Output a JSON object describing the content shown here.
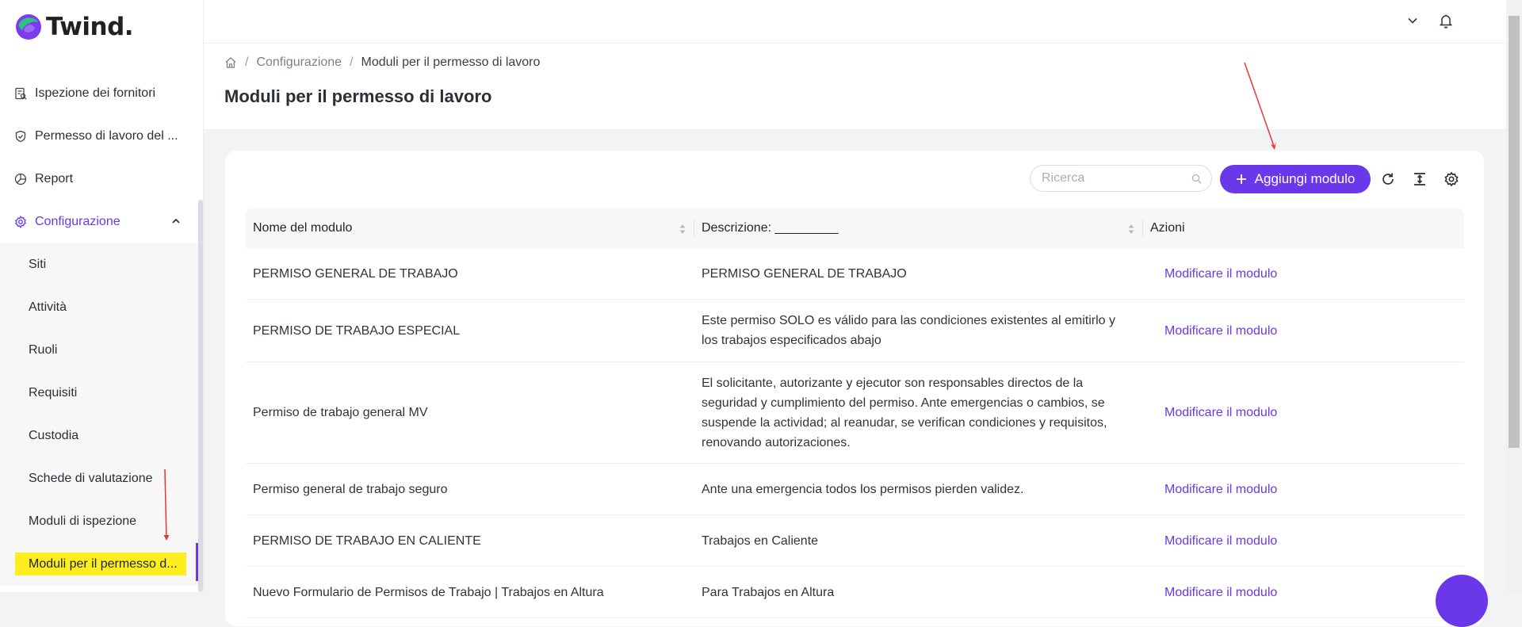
{
  "app": {
    "brand": "Twind.",
    "accent": "#6a38ea"
  },
  "sidebar": {
    "items": [
      {
        "label": "Ispezione dei fornitori",
        "icon": "inspection-icon"
      },
      {
        "label": "Permesso di lavoro del ...",
        "icon": "shield-icon"
      },
      {
        "label": "Report",
        "icon": "pie-chart-icon"
      },
      {
        "label": "Configurazione",
        "icon": "gear-icon",
        "expanded": true
      }
    ],
    "subitems": [
      {
        "label": "Siti"
      },
      {
        "label": "Attività"
      },
      {
        "label": "Ruoli"
      },
      {
        "label": "Requisiti"
      },
      {
        "label": "Custodia"
      },
      {
        "label": "Schede di valutazione"
      },
      {
        "label": "Moduli di ispezione"
      },
      {
        "label": "Moduli per il permesso d...",
        "selected": true
      }
    ]
  },
  "breadcrumb": {
    "level1": "Configurazione",
    "current": "Moduli per il permesso di lavoro"
  },
  "page_title": "Moduli per il permesso di lavoro",
  "toolbar": {
    "search_placeholder": "Ricerca",
    "add_label": "Aggiungi modulo"
  },
  "table": {
    "columns": [
      "Nome del modulo",
      "Descrizione: _________",
      "Azioni"
    ],
    "rows": [
      {
        "name": "PERMISO GENERAL DE TRABAJO",
        "description": "PERMISO GENERAL DE TRABAJO",
        "action": "Modificare il modulo"
      },
      {
        "name": "PERMISO DE TRABAJO ESPECIAL",
        "description": "Este permiso SOLO es válido para las condiciones existentes al emitirlo y los trabajos especificados abajo",
        "action": "Modificare il modulo"
      },
      {
        "name": "Permiso de trabajo general MV",
        "description": "El solicitante, autorizante y ejecutor son responsables directos de la seguridad y cumplimiento del permiso. Ante emergencias o cambios, se suspende la actividad; al reanudar, se verifican condiciones y requisitos, renovando autorizaciones.",
        "action": "Modificare il modulo"
      },
      {
        "name": "Permiso general de trabajo seguro",
        "description": "Ante una emergencia todos los permisos pierden validez.",
        "action": "Modificare il modulo"
      },
      {
        "name": "PERMISO DE TRABAJO EN CALIENTE",
        "description": "Trabajos en Caliente",
        "action": "Modificare il modulo"
      },
      {
        "name": "Nuevo Formulario de Permisos de Trabajo | Trabajos en Altura",
        "description": "Para Trabajos en Altura",
        "action": "Modificare il modulo"
      }
    ]
  }
}
